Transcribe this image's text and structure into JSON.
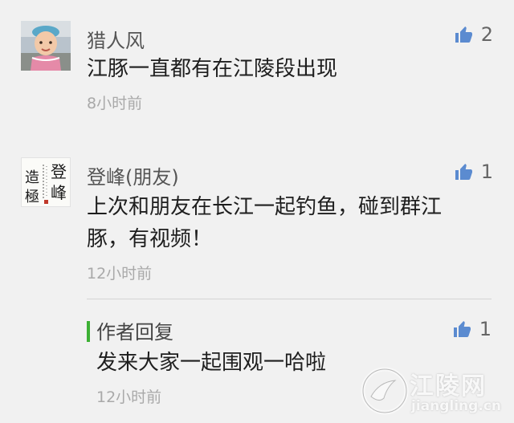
{
  "comments": [
    {
      "user": "猎人风",
      "text": "江豚一直都有在江陵段出现",
      "time": "8小时前",
      "likes": "2",
      "avatar_icon": "child-photo-avatar"
    },
    {
      "user": "登峰(朋友)",
      "text": "上次和朋友在长江一起钓鱼，碰到群江豚，有视频！",
      "time": "12小时前",
      "likes": "1",
      "avatar_icon": "calligraphy-avatar",
      "avatar_calligraphy": [
        "登",
        "峰",
        "造",
        "極"
      ],
      "reply": {
        "title": "作者回复",
        "text": "发来大家一起围观一哈啦",
        "time": "12小时前",
        "likes": "1"
      }
    }
  ],
  "watermark": {
    "name": "江陵网",
    "domain": "jiangling.cn"
  },
  "colors": {
    "background": "#f1f1f1",
    "like_icon": "#5b8bd0",
    "reply_accent": "#3cb034",
    "timestamp": "#a9a9a9"
  }
}
